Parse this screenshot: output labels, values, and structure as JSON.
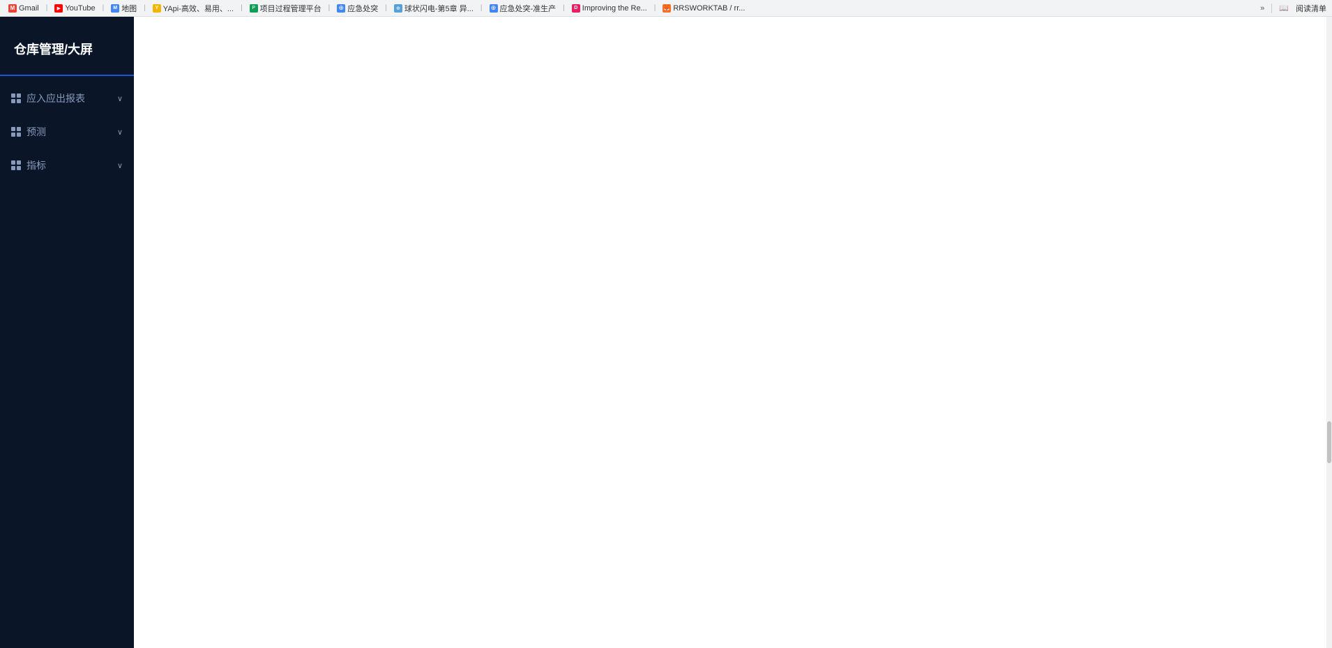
{
  "browser": {
    "tabs": [
      {
        "id": "gmail",
        "label": "Gmail",
        "icon_color": "#EA4335",
        "icon_letter": "M"
      },
      {
        "id": "youtube",
        "label": "YouTube",
        "icon_color": "#FF0000",
        "icon_letter": "▶"
      },
      {
        "id": "maps",
        "label": "地图",
        "icon_color": "#4285F4",
        "icon_letter": "M"
      },
      {
        "id": "yapi",
        "label": "YApi-高效、易用、...",
        "icon_color": "#F4B400",
        "icon_letter": "Y"
      },
      {
        "id": "project",
        "label": "项目过程管理平台",
        "icon_color": "#0F9D58",
        "icon_letter": "P"
      },
      {
        "id": "emergency1",
        "label": "应急处突",
        "icon_color": "#4285F4",
        "icon_letter": "⊕"
      },
      {
        "id": "ball",
        "label": "球状闪电-第5章 异...",
        "icon_color": "#4285F4",
        "icon_letter": "⊕"
      },
      {
        "id": "emergency2",
        "label": "应急处突-准生产",
        "icon_color": "#4285F4",
        "icon_letter": "⊕"
      },
      {
        "id": "improving",
        "label": "Improving the Re...",
        "icon_color": "#E91E63",
        "icon_letter": "D"
      },
      {
        "id": "rrs",
        "label": "RRSWORKTAB / rr...",
        "icon_color": "#FC6D26",
        "icon_letter": "🦊"
      }
    ],
    "more_label": "»",
    "reader_label": "阅读清单"
  },
  "sidebar": {
    "title": "仓库管理/大屏",
    "nav_items": [
      {
        "id": "reports",
        "label": "应入应出报表",
        "has_chevron": true
      },
      {
        "id": "forecast",
        "label": "预测",
        "has_chevron": true
      },
      {
        "id": "metrics",
        "label": "指标",
        "has_chevron": true
      }
    ]
  },
  "main": {
    "content": ""
  }
}
